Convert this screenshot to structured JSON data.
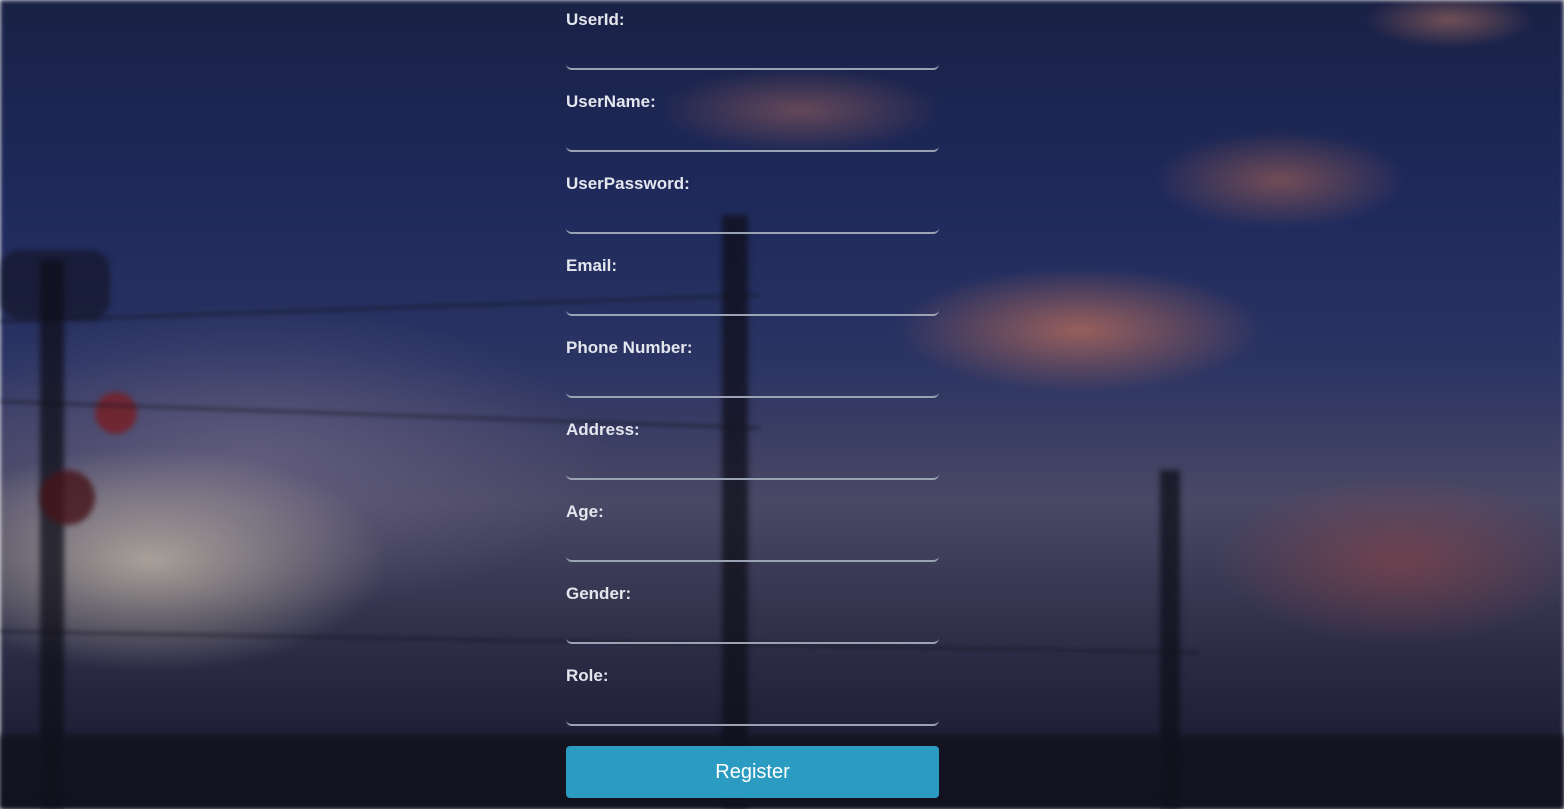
{
  "form": {
    "fields": [
      {
        "label": "UserId:",
        "value": ""
      },
      {
        "label": "UserName:",
        "value": ""
      },
      {
        "label": "UserPassword:",
        "value": ""
      },
      {
        "label": "Email:",
        "value": ""
      },
      {
        "label": "Phone Number:",
        "value": ""
      },
      {
        "label": "Address:",
        "value": ""
      },
      {
        "label": "Age:",
        "value": ""
      },
      {
        "label": "Gender:",
        "value": ""
      },
      {
        "label": "Role:",
        "value": ""
      }
    ],
    "submit_label": "Register"
  },
  "colors": {
    "button": "#2b9bc1",
    "label": "#e4e6ee",
    "input_border": "#9aa3b4"
  }
}
